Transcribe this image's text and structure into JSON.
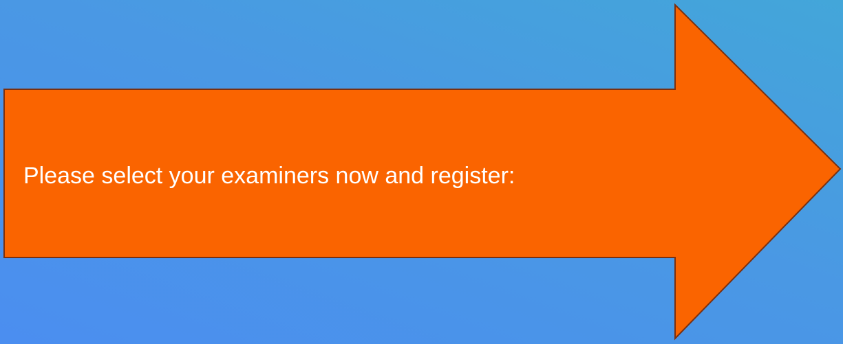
{
  "arrow": {
    "label": "Please select your examiners now and register:",
    "fill_color": "#fa6400",
    "stroke_color": "#7a3010",
    "text_color": "#ffffff"
  },
  "background": {
    "gradient_colors": [
      "#43a6d9",
      "#4a98e4",
      "#4b8ef0"
    ]
  }
}
